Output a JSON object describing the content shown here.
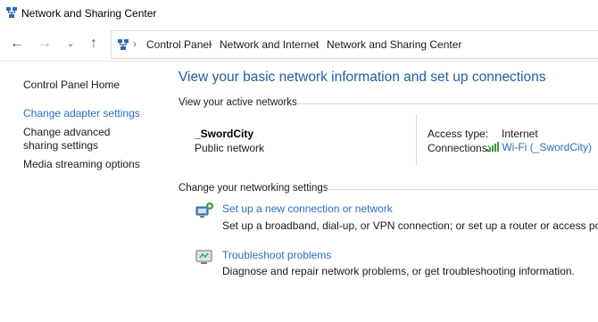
{
  "window": {
    "title": "Network and Sharing Center"
  },
  "breadcrumb": [
    "Control Panel",
    "Network and Internet",
    "Network and Sharing Center"
  ],
  "sidebar": {
    "items": [
      {
        "label": "Control Panel Home"
      },
      {
        "label": "Change adapter settings"
      },
      {
        "label": "Change advanced sharing settings"
      },
      {
        "label": "Media streaming options"
      }
    ]
  },
  "main": {
    "title": "View your basic network information and set up connections",
    "active_networks_label": "View your active networks",
    "network": {
      "name": "_SwordCity",
      "type": "Public network",
      "access_type_label": "Access type:",
      "access_type_value": "Internet",
      "connections_label": "Connections:",
      "connections_value": "Wi-Fi (_SwordCity)"
    },
    "change_settings_label": "Change your networking settings",
    "tasks": [
      {
        "title": "Set up a new connection or network",
        "desc": "Set up a broadband, dial-up, or VPN connection; or set up a router or access point."
      },
      {
        "title": "Troubleshoot problems",
        "desc": "Diagnose and repair network problems, or get troubleshooting information."
      }
    ]
  },
  "colors": {
    "link": "#2a6fb7",
    "title": "#1f5fa6",
    "signal": "#3a9a3a"
  },
  "icons": [
    "network-center-icon",
    "back-arrow-icon",
    "forward-arrow-icon",
    "recent-dropdown-icon",
    "up-arrow-icon",
    "wifi-signal-icon",
    "new-connection-icon",
    "troubleshoot-icon"
  ]
}
